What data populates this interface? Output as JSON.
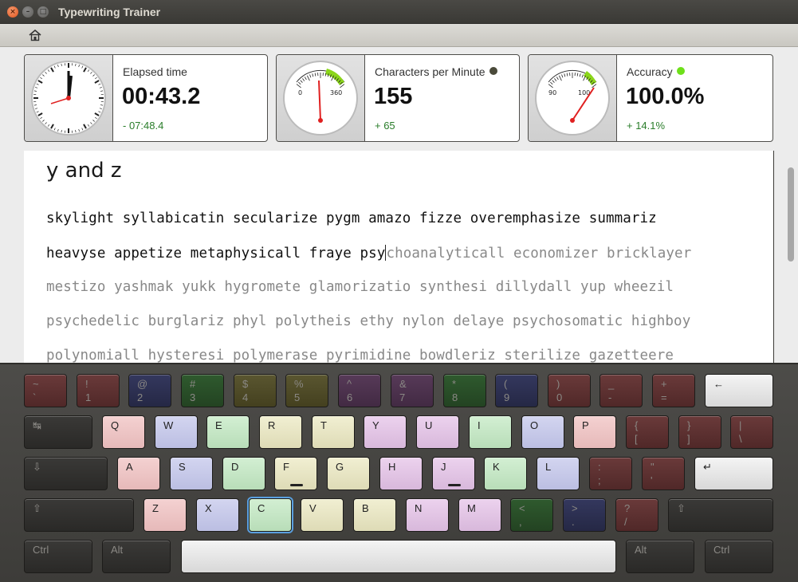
{
  "window": {
    "title": "Typewriting Trainer"
  },
  "toolbar": {
    "home_icon": "home-icon"
  },
  "stats": {
    "elapsed": {
      "label": "Elapsed time",
      "value": "00:43.2",
      "delta": "- 07:48.4"
    },
    "cpm": {
      "label": "Characters per Minute",
      "value": "155",
      "delta": "+ 65",
      "gauge_min": "0",
      "gauge_max": "360",
      "indicator_color": "#4a4a3a"
    },
    "accuracy": {
      "label": "Accuracy",
      "value": "100.0%",
      "delta": "+ 14.1%",
      "gauge_min": "90",
      "gauge_max": "100",
      "indicator_color": "#6ee01a"
    }
  },
  "lesson": {
    "title": "y and z",
    "line1": "skylight syllabicatin secularize pygm amazo fizze overemphasize summariz",
    "line2_typed": "heavyse appetize metaphysicall fraye psy",
    "line2_pending": "choanalyticall economizer bricklayer",
    "line3": "mestizo yashmak yukk hygromete glamorizatio synthesi dillydall yup wheezil",
    "line4": "psychedelic burglariz phyl polytheis ethy nylon delaye psychosomatic highboy",
    "line5": "polynomiall hysteresi polymerase pyrimidine bowdleriz sterilize gazetteere"
  },
  "keyboard": {
    "row1": [
      {
        "top": "~",
        "bottom": "`"
      },
      {
        "top": "!",
        "bottom": "1"
      },
      {
        "top": "@",
        "bottom": "2"
      },
      {
        "top": "#",
        "bottom": "3"
      },
      {
        "top": "$",
        "bottom": "4"
      },
      {
        "top": "%",
        "bottom": "5"
      },
      {
        "top": "^",
        "bottom": "6"
      },
      {
        "top": "&",
        "bottom": "7"
      },
      {
        "top": "*",
        "bottom": "8"
      },
      {
        "top": "(",
        "bottom": "9"
      },
      {
        "top": ")",
        "bottom": "0"
      },
      {
        "top": "_",
        "bottom": "-"
      },
      {
        "top": "+",
        "bottom": "="
      },
      {
        "top": "←",
        "bottom": ""
      }
    ],
    "row2": [
      {
        "top": "↹",
        "bottom": ""
      },
      {
        "top": "Q"
      },
      {
        "top": "W"
      },
      {
        "top": "E"
      },
      {
        "top": "R"
      },
      {
        "top": "T"
      },
      {
        "top": "Y"
      },
      {
        "top": "U"
      },
      {
        "top": "I"
      },
      {
        "top": "O"
      },
      {
        "top": "P"
      },
      {
        "top": "{",
        "bottom": "["
      },
      {
        "top": "}",
        "bottom": "]"
      },
      {
        "top": "|",
        "bottom": "\\"
      }
    ],
    "row3": [
      {
        "top": "⇩"
      },
      {
        "top": "A"
      },
      {
        "top": "S"
      },
      {
        "top": "D"
      },
      {
        "top": "F"
      },
      {
        "top": "G"
      },
      {
        "top": "H"
      },
      {
        "top": "J"
      },
      {
        "top": "K"
      },
      {
        "top": "L"
      },
      {
        "top": ":",
        "bottom": ";"
      },
      {
        "top": "\"",
        "bottom": "'"
      },
      {
        "top": "↵"
      }
    ],
    "row4": [
      {
        "top": "⇧"
      },
      {
        "top": "Z"
      },
      {
        "top": "X"
      },
      {
        "top": "C"
      },
      {
        "top": "V"
      },
      {
        "top": "B"
      },
      {
        "top": "N"
      },
      {
        "top": "M"
      },
      {
        "top": "<",
        "bottom": ","
      },
      {
        "top": ">",
        "bottom": "."
      },
      {
        "top": "?",
        "bottom": "/"
      },
      {
        "top": "⇧"
      }
    ],
    "row5": [
      {
        "top": "Ctrl"
      },
      {
        "top": "Alt"
      },
      {
        "top": ""
      },
      {
        "top": "Alt"
      },
      {
        "top": "Ctrl"
      }
    ]
  }
}
